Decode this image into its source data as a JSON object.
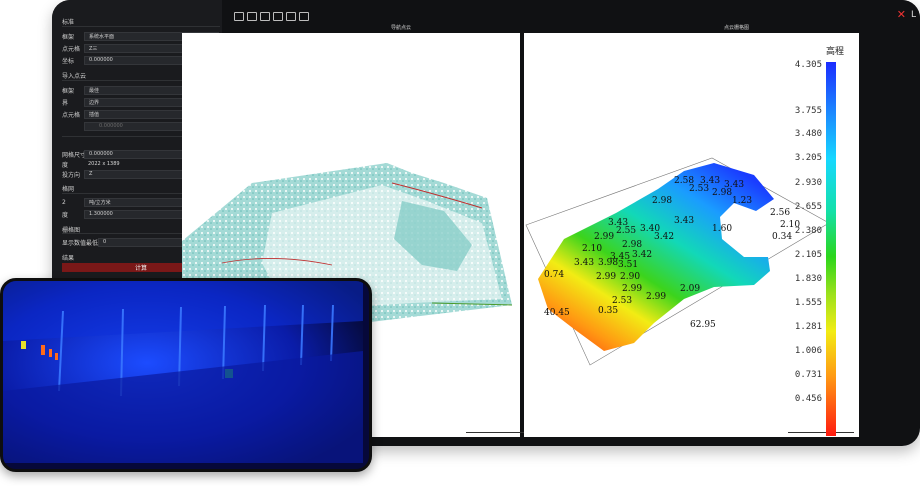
{
  "sidebar": {
    "sections": [
      "标准",
      "导入点云",
      "格网",
      "栅格图",
      "结果"
    ],
    "rows": [
      {
        "label": "框架",
        "value": "系统水平面"
      },
      {
        "label": "点元格",
        "value": "Z三"
      },
      {
        "label": "坐标",
        "value": "0.000000"
      },
      {
        "label": "框架",
        "value": "最佳"
      },
      {
        "label": "界",
        "value": "边界"
      },
      {
        "label": "点元格",
        "value": "插值"
      },
      {
        "label": "",
        "value": "0.000000"
      },
      {
        "label": "网格尺寸",
        "value": "0.000000"
      },
      {
        "label": "度",
        "value": "2022 x 1389"
      },
      {
        "label": "投方向",
        "value": "Z"
      },
      {
        "label": "2",
        "value": "吨/立方米"
      },
      {
        "label": "度",
        "value": "1.300000"
      },
      {
        "label": "显示数值最低",
        "value": "0"
      }
    ],
    "calc_button": "计算"
  },
  "toolbar": {
    "icons": [
      "open-icon",
      "save-icon",
      "export-icon",
      "copy-icon",
      "screenshot-icon"
    ]
  },
  "panels": {
    "left_title": "导航点云",
    "right_title": "点云栅格图"
  },
  "legend": {
    "title": "高程",
    "ticks": [
      "4.305",
      "3.755",
      "3.480",
      "3.205",
      "2.930",
      "2.655",
      "2.380",
      "2.105",
      "1.830",
      "1.555",
      "1.281",
      "1.006",
      "0.731",
      "0.456"
    ]
  },
  "heightmap": {
    "labels": [
      "2.58",
      "3.43",
      "2.53",
      "2.98",
      "3.43",
      "1.23",
      "2.98",
      "3.43",
      "3.43",
      "2.99",
      "2.55",
      "3.40",
      "3.42",
      "2.10",
      "2.98",
      "1.60",
      "3.43",
      "3.98",
      "3.42",
      "3.45",
      "3.51",
      "0.74",
      "2.99",
      "2.90",
      "2.99",
      "2.09",
      "2.53",
      "2.99",
      "0.35",
      "2.56",
      "2.10",
      "0.34"
    ],
    "dimensions": [
      "40.45",
      "62.95"
    ]
  },
  "colors": {
    "accent": "#7a1818",
    "close": "#ee3333"
  }
}
